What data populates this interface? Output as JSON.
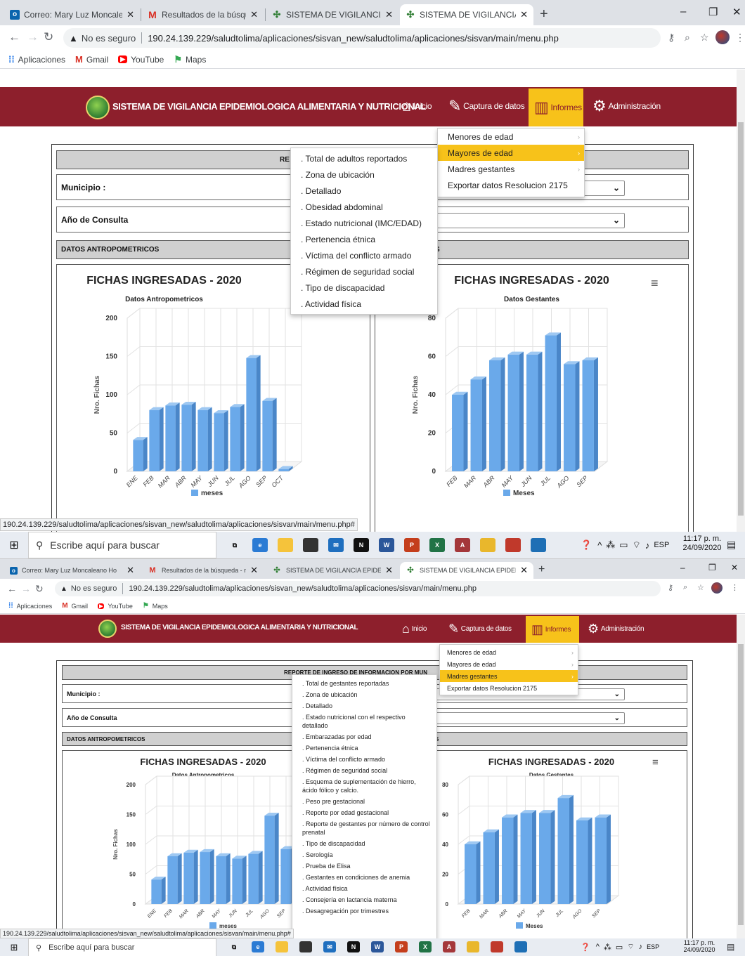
{
  "browser": {
    "tabs": [
      {
        "title": "Correo: Mary Luz Moncaleano Ho",
        "icon": "outlook-icon"
      },
      {
        "title": "Resultados de la búsqueda - mlm",
        "icon": "gmail-icon"
      },
      {
        "title": "SISTEMA DE VIGILANCIA EPIDEM",
        "icon": "leaf-icon"
      },
      {
        "title": "SISTEMA DE VIGILANCIA EPIDEM",
        "icon": "leaf-icon"
      }
    ],
    "new_tab": "+",
    "security_label": "No es seguro",
    "url": "190.24.139.229/saludtolima/aplicaciones/sisvan_new/saludtolima/aplicaciones/sisvan/main/menu.php",
    "bookmarks": [
      "Aplicaciones",
      "Gmail",
      "YouTube",
      "Maps"
    ]
  },
  "header": {
    "system_title": "SISTEMA DE VIGILANCIA EPIDEMIOLOGICA ALIMENTARIA Y NUTRICIONAL",
    "nav": [
      {
        "label": "Inicio",
        "icon": "home-icon"
      },
      {
        "label": "Captura de datos",
        "icon": "edit-icon"
      },
      {
        "label": "Informes",
        "icon": "bar-chart-icon"
      },
      {
        "label": "Administración",
        "icon": "gear-icon"
      }
    ],
    "active_nav": "Informes",
    "active_color": "#f7c21a",
    "brand_color": "#8d1f2c"
  },
  "informes_menu": [
    {
      "label": "Menores de edad"
    },
    {
      "label": "Mayores de edad"
    },
    {
      "label": "Madres gestantes"
    },
    {
      "label": "Exportar datos Resolucion 2175"
    }
  ],
  "screen1": {
    "active_menu": "Mayores de edad",
    "report_title_partial": "RE",
    "submenu": [
      ". Total de adultos reportados",
      ". Zona de ubicación",
      ". Detallado",
      ". Obesidad abdominal",
      ". Estado nutricional (IMC/EDAD)",
      ". Pertenencia étnica",
      ". Víctima del conflicto armado",
      ". Régimen de seguridad social",
      ". Tipo de discapacidad",
      ". Actividad física"
    ]
  },
  "screen2": {
    "active_menu": "Madres gestantes",
    "report_title_partial": "REPORTE DE INGRESO DE INFORMACION POR MUN",
    "submenu": [
      ". Total de gestantes reportadas",
      ". Zona de ubicación",
      ". Detallado",
      ". Estado nutricional con el respectivo detallado",
      ". Embarazadas por edad",
      ". Pertenencia étnica",
      ". Víctima del conflicto armado",
      ". Régimen de seguridad social",
      ". Esquema de suplementación de hierro, ácido fólico y calcio.",
      ". Peso pre gestacional",
      ". Reporte por edad gestacional",
      ". Reporte de gestantes por número de control prenatal",
      ". Tipo de discapacidad",
      ". Serología",
      ". Prueba de Elisa",
      ". Gestantes en condiciones de anemia",
      ". Actividad física",
      ". Consejería en lactancia materna",
      ". Desagregación por trimestres"
    ]
  },
  "form": {
    "municipio_label": "Municipio :",
    "anio_label": "Año de Consulta",
    "section_label": "DATOS ANTROPOMETRICOS",
    "section_right_partial": "S"
  },
  "chart_data": [
    {
      "type": "bar",
      "title": "FICHAS INGRESADAS - 2020",
      "subtitle": "Datos Antropometricos",
      "ylabel": "Nro. Fichas",
      "xlabel": "",
      "categories": [
        "ENE",
        "FEB",
        "MAR",
        "ABR",
        "MAY",
        "JUN",
        "JUL",
        "AGO",
        "SEP",
        "OCT"
      ],
      "series": [
        {
          "name": "meses",
          "values": [
            41,
            80,
            86,
            87,
            80,
            76,
            84,
            148,
            92,
            3
          ]
        }
      ],
      "ylim": [
        0,
        200
      ],
      "yticks": [
        0,
        50,
        100,
        150,
        200
      ],
      "bar_color": "#6aa9ea",
      "legend": "bottom-center"
    },
    {
      "type": "bar",
      "title": "FICHAS INGRESADAS - 2020",
      "subtitle": "Datos Gestantes",
      "ylabel": "Nro. Fichas",
      "xlabel": "",
      "categories": [
        "FEB",
        "MAR",
        "ABR",
        "MAY",
        "JUN",
        "JUL",
        "AGO",
        "SEP"
      ],
      "series": [
        {
          "name": "Meses",
          "values": [
            40,
            48,
            58,
            61,
            61,
            71,
            56,
            58
          ]
        }
      ],
      "ylim": [
        0,
        80
      ],
      "yticks": [
        0,
        20,
        40,
        60,
        80
      ],
      "bar_color": "#6aa9ea",
      "legend": "bottom-center"
    }
  ],
  "status_url": "190.24.139.229/saludtolima/aplicaciones/sisvan_new/saludtolima/aplicaciones/sisvan/main/menu.php#",
  "taskbar": {
    "search_placeholder": "Escribe aquí para buscar",
    "apps": [
      {
        "name": "task-view-icon",
        "letter": "⧉",
        "color": "#e8ecf2"
      },
      {
        "name": "edge-icon",
        "letter": "e",
        "color": "#2b7bd4"
      },
      {
        "name": "file-explorer-icon",
        "letter": "",
        "color": "#f5c33b"
      },
      {
        "name": "store-icon",
        "letter": "",
        "color": "#333333"
      },
      {
        "name": "mail-icon",
        "letter": "✉",
        "color": "#1f6fbf"
      },
      {
        "name": "netflix-icon",
        "letter": "N",
        "color": "#111111"
      },
      {
        "name": "word-icon",
        "letter": "W",
        "color": "#2b579a"
      },
      {
        "name": "powerpoint-icon",
        "letter": "P",
        "color": "#c43e1c"
      },
      {
        "name": "excel-icon",
        "letter": "X",
        "color": "#217346"
      },
      {
        "name": "access-icon",
        "letter": "A",
        "color": "#a4373a"
      },
      {
        "name": "chrome-icon",
        "letter": "",
        "color": "#e9b72c"
      },
      {
        "name": "paint-icon",
        "letter": "",
        "color": "#c0392b"
      },
      {
        "name": "photos-icon",
        "letter": "",
        "color": "#1e6fb5"
      }
    ],
    "language": "ESP",
    "time": "11:17 p. m.",
    "date": "24/09/2020",
    "notifications": "1"
  }
}
